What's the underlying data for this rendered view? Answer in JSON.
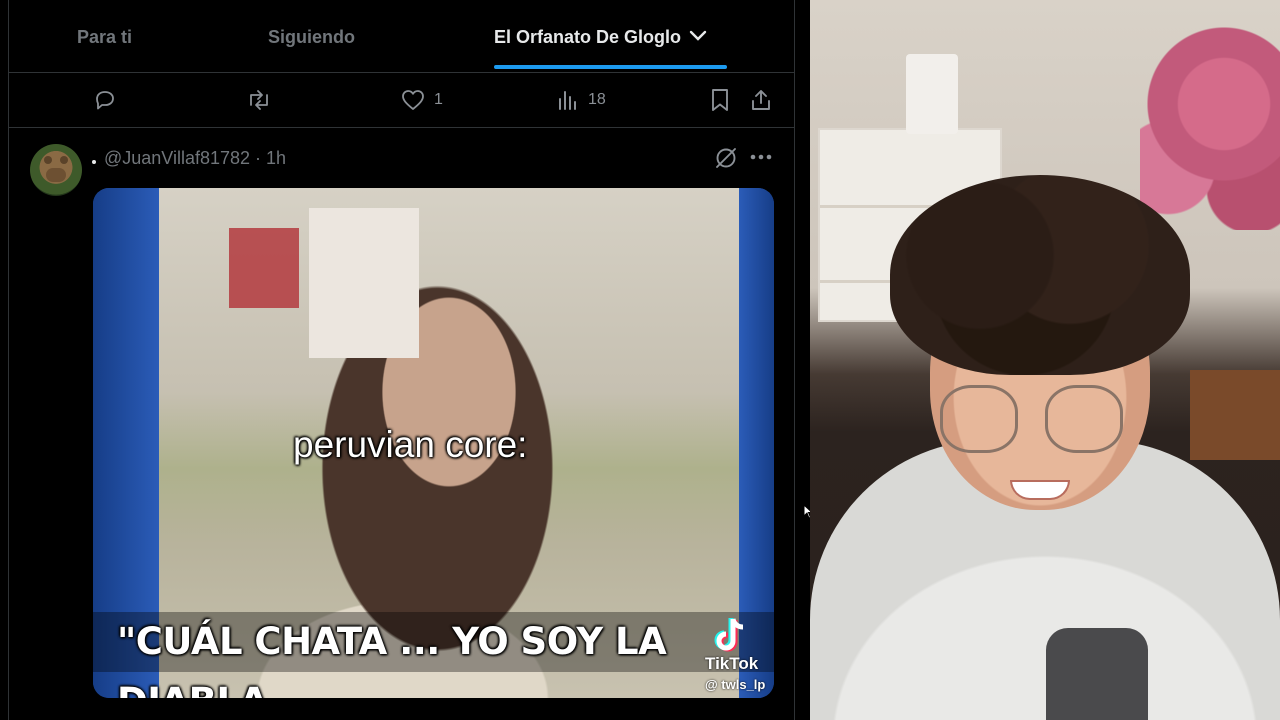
{
  "tabs": [
    {
      "label": "Para ti",
      "active": false
    },
    {
      "label": "Siguiendo",
      "active": false
    },
    {
      "label": "El Orfanato De Gloglo",
      "active": true
    }
  ],
  "accent_color": "#1d9bf0",
  "actions": {
    "reply": {
      "icon": "reply-icon",
      "count": ""
    },
    "repost": {
      "icon": "repost-icon",
      "count": ""
    },
    "like": {
      "icon": "heart-icon",
      "count": "1"
    },
    "views": {
      "icon": "views-icon",
      "count": "18"
    },
    "bookmark": {
      "icon": "bookmark-icon"
    },
    "share": {
      "icon": "share-icon"
    }
  },
  "post": {
    "handle": "@JuanVillaf81782 · 1h",
    "media": {
      "caption_top": "peruvian core:",
      "caption_bottom": "\"CUÁL CHATA ... YO SOY LA DIABLA",
      "watermark_brand": "TikTok",
      "watermark_user": "@ twls_lp"
    }
  }
}
